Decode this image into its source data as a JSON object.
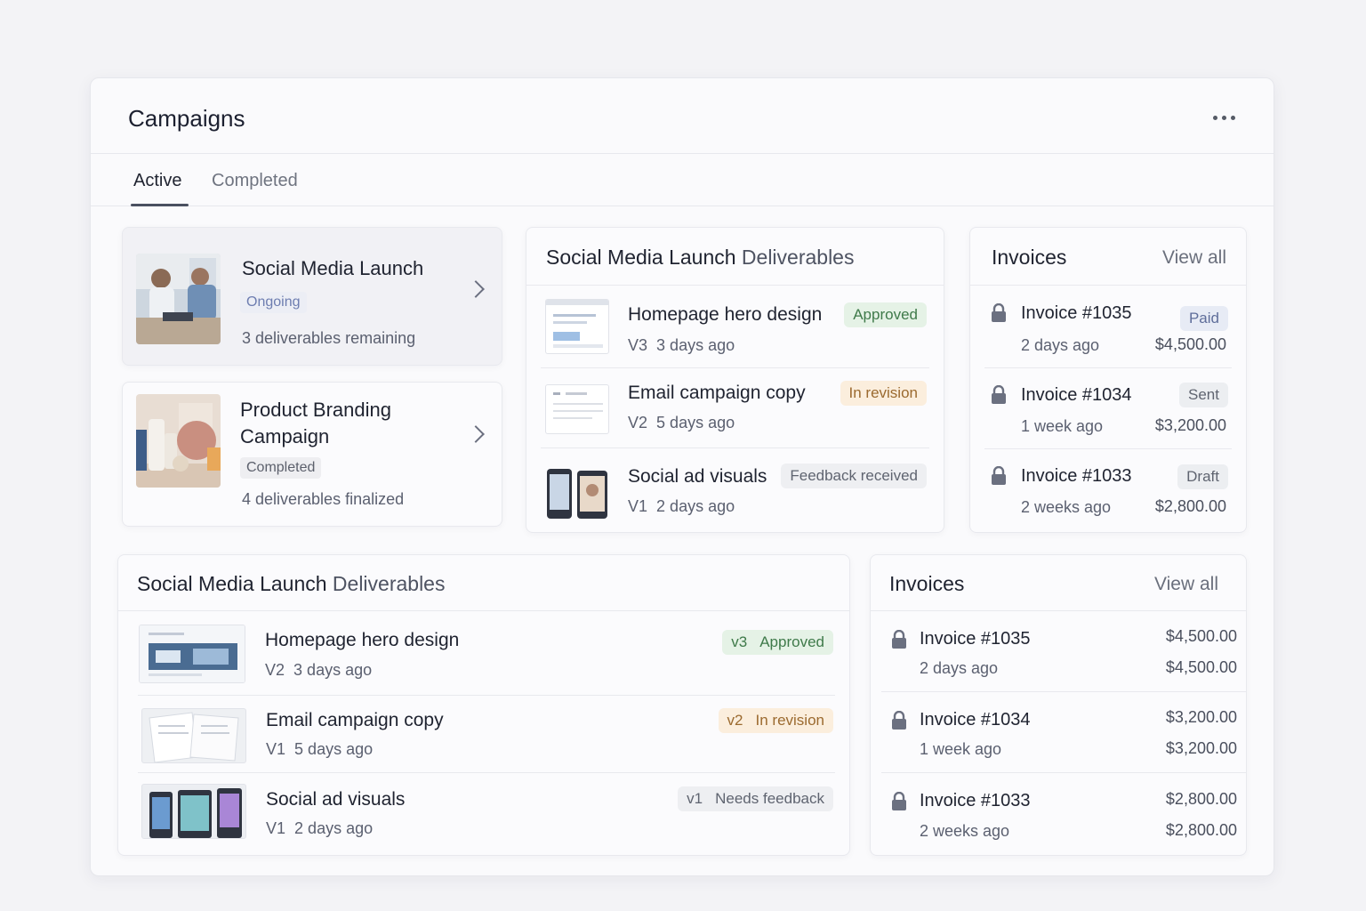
{
  "header": {
    "title": "Campaigns"
  },
  "tabs": [
    {
      "label": "Active"
    },
    {
      "label": "Completed"
    }
  ],
  "campaigns": [
    {
      "title": "Social Media Launch",
      "status": "Ongoing",
      "summary": "3 deliverables remaining"
    },
    {
      "title": "Product Branding Campaign",
      "status": "Completed",
      "summary": "4 deliverables finalized"
    }
  ],
  "deliverables_top": {
    "title_bold": "Social Media Launch",
    "title_light": "Deliverables",
    "items": [
      {
        "name": "Homepage hero design",
        "version": "V3",
        "time": "3 days ago",
        "status": "Approved"
      },
      {
        "name": "Email campaign copy",
        "version": "V2",
        "time": "5 days ago",
        "status": "In revision"
      },
      {
        "name": "Social ad visuals",
        "version": "V1",
        "time": "2 days ago",
        "status": "Feedback received"
      }
    ]
  },
  "invoices_top": {
    "title": "Invoices",
    "view_all": "View all",
    "items": [
      {
        "number": "Invoice #1035",
        "time": "2 days ago",
        "status": "Paid",
        "amount": "$4,500.00"
      },
      {
        "number": "Invoice #1034",
        "time": "1 week ago",
        "status": "Sent",
        "amount": "$3,200.00"
      },
      {
        "number": "Invoice #1033",
        "time": "2 weeks ago",
        "status": "Draft",
        "amount": "$2,800.00"
      }
    ]
  },
  "deliverables_bottom": {
    "title_bold": "Social Media Launch",
    "title_light": "Deliverables",
    "items": [
      {
        "name": "Homepage hero design",
        "version": "V2",
        "time": "3 days ago",
        "badge_version": "v3",
        "status": "Approved"
      },
      {
        "name": "Email campaign copy",
        "version": "V1",
        "time": "5 days ago",
        "badge_version": "v2",
        "status": "In revision"
      },
      {
        "name": "Social ad visuals",
        "version": "V1",
        "time": "2 days ago",
        "badge_version": "v1",
        "status": "Needs feedback"
      }
    ]
  },
  "invoices_bottom": {
    "title": "Invoices",
    "view_all": "View all",
    "items": [
      {
        "number": "Invoice #1035",
        "time": "2 days ago",
        "amount_top": "$4,500.00",
        "amount_bottom": "$4,500.00"
      },
      {
        "number": "Invoice #1034",
        "time": "1 week ago",
        "amount_top": "$3,200.00",
        "amount_bottom": "$3,200.00"
      },
      {
        "number": "Invoice #1033",
        "time": "2 weeks ago",
        "amount_top": "$2,800.00",
        "amount_bottom": "$2,800.00"
      }
    ]
  },
  "icons": {
    "lock": "lock-icon",
    "more": "more-horizontal-icon",
    "chevron": "chevron-right-icon"
  }
}
